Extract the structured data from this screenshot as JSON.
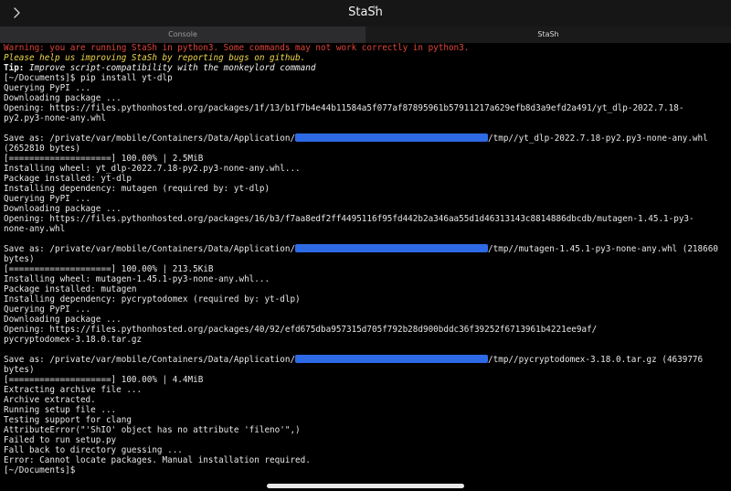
{
  "window": {
    "title": "StaSh"
  },
  "tabs": {
    "console": "Console",
    "close": "×",
    "stash": "StaSh"
  },
  "terminal": {
    "warning": "Warning: you are running StaSh in python3. Some commands may not work correctly in python3.",
    "help": "Please help us improving StaSh by reporting bugs on github.",
    "tip_label": "Tip:",
    "tip_text": " Improve script-compatibility with the monkeylord command",
    "lines_a": [
      "[~/Documents]$ pip install yt-dlp",
      "Querying PyPI ...",
      "Downloading package ...",
      "Opening: https://files.pythonhosted.org/packages/1f/13/b1f7b4e44b11584a5f077af87895961b57911217a629efb8d3a9efd2a491/yt_dlp-2022.7.18-",
      "py2.py3-none-any.whl",
      ""
    ],
    "save1_prefix": "Save as: /private/var/mobile/Containers/Data/Application/",
    "save1_suffix": "/tmp//yt_dlp-2022.7.18-py2.py3-none-any.whl",
    "lines_b": [
      "(2652810 bytes)",
      "[====================] 100.00% | 2.5MiB",
      "Installing wheel: yt_dlp-2022.7.18-py2.py3-none-any.whl...",
      "Package installed: yt-dlp",
      "Installing dependency: mutagen (required by: yt-dlp)",
      "Querying PyPI ...",
      "Downloading package ...",
      "Opening: https://files.pythonhosted.org/packages/16/b3/f7aa8edf2ff4495116f95fd442b2a346aa55d1d46313143c8814886dbcdb/mutagen-1.45.1-py3-",
      "none-any.whl",
      ""
    ],
    "save2_prefix": "Save as: /private/var/mobile/Containers/Data/Application/",
    "save2_suffix": "/tmp//mutagen-1.45.1-py3-none-any.whl (218660",
    "lines_c": [
      "bytes)",
      "[====================] 100.00% | 213.5KiB",
      "Installing wheel: mutagen-1.45.1-py3-none-any.whl...",
      "Package installed: mutagen",
      "Installing dependency: pycryptodomex (required by: yt-dlp)",
      "Querying PyPI ...",
      "Downloading package ...",
      "Opening: https://files.pythonhosted.org/packages/40/92/efd675dba957315d705f792b28d900bddc36f39252f6713961b4221ee9af/",
      "pycryptodomex-3.18.0.tar.gz",
      ""
    ],
    "save3_prefix": "Save as: /private/var/mobile/Containers/Data/Application/",
    "save3_suffix": "/tmp//pycryptodomex-3.18.0.tar.gz (4639776",
    "lines_d": [
      "bytes)",
      "[====================] 100.00% | 4.4MiB",
      "Extracting archive file ...",
      "Archive extracted.",
      "Running setup file ...",
      "Testing support for clang",
      "AttributeError(\"'ShIO' object has no attribute 'fileno'\",)",
      "Failed to run setup.py",
      "Fall back to directory guessing ...",
      "Error: Cannot locate packages. Manual installation required.",
      "[~/Documents]$"
    ]
  }
}
